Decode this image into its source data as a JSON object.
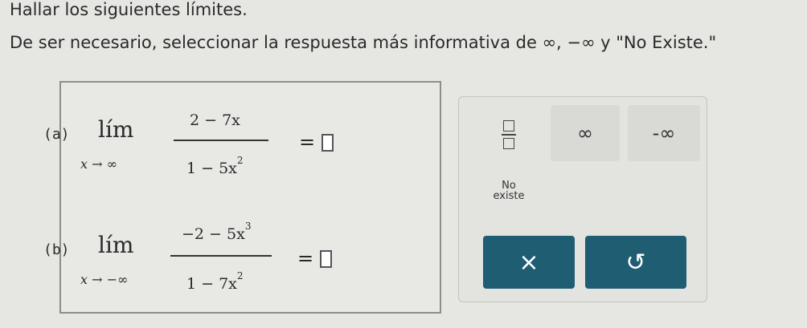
{
  "instructions": {
    "line1": "Hallar los siguientes límites.",
    "line2": "De ser necesario, seleccionar la respuesta más informativa de ∞, −∞ y \"No Existe.\""
  },
  "problems": [
    {
      "label": "(a)",
      "lim": "lím",
      "sub_var": "x",
      "sub_arrow": "→",
      "sub_target": "∞",
      "numerator": "2 − 7x",
      "denominator": "1 − 5x",
      "den_exp": "2",
      "num_exp": "",
      "equals": "="
    },
    {
      "label": "(b)",
      "lim": "lím",
      "sub_var": "x",
      "sub_arrow": "→",
      "sub_target": "−∞",
      "numerator": "−2 − 5x",
      "num_exp": "3",
      "denominator": "1 − 7x",
      "den_exp": "2",
      "equals": "="
    }
  ],
  "keypad": {
    "infinity": "∞",
    "neg_infinity": "-∞",
    "no_existe_line1": "No",
    "no_existe_line2": "existe",
    "clear": "×",
    "undo": "↺"
  }
}
